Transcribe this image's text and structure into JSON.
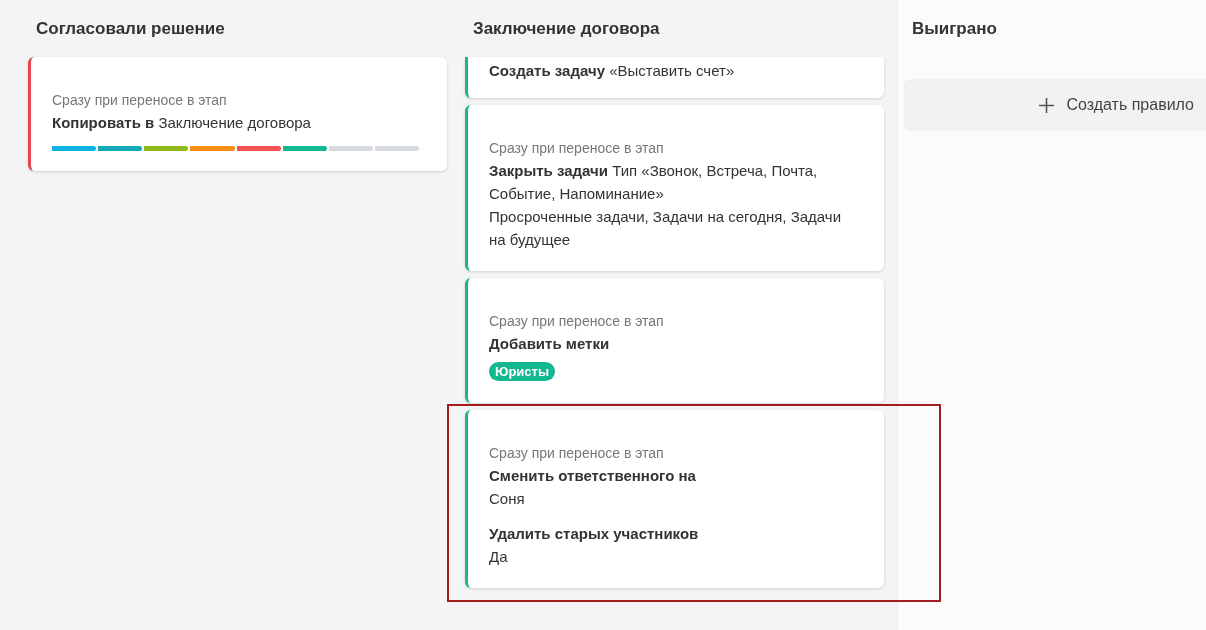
{
  "columns": [
    {
      "title": "Согласовали решение",
      "color": "#e4474f",
      "cards": [
        {
          "cut_top": false,
          "highlighted": false,
          "trigger": "Сразу при переносе в этап",
          "blocks": [
            {
              "kind": "line",
              "text": "**Копировать в** Заключение договора"
            },
            {
              "kind": "pipeline",
              "segments": [
                {
                  "color": "#0cb2e0"
                },
                {
                  "color": "#13abba"
                },
                {
                  "color": "#92b91a"
                },
                {
                  "color": "#fb8c14"
                },
                {
                  "color": "#f35353"
                },
                {
                  "color": "#14b890"
                },
                {
                  "color": "#d6dade"
                },
                {
                  "color": "#d6dade"
                }
              ]
            }
          ]
        }
      ]
    },
    {
      "title": "Заключение договора",
      "color": "#1cb58c",
      "cards": [
        {
          "cut_top": true,
          "highlighted": false,
          "blocks": [
            {
              "kind": "line",
              "text": "**Создать задачу** «Выставить счет»"
            }
          ]
        },
        {
          "cut_top": false,
          "highlighted": false,
          "trigger": "Сразу при переносе в этап",
          "blocks": [
            {
              "kind": "line",
              "text": "**Закрыть задачи** Тип «Звонок, Встреча, Почта, Событие, Напоминание»"
            },
            {
              "kind": "line",
              "text": "Просроченные задачи, Задачи на сегодня, Задачи на будущее"
            }
          ]
        },
        {
          "cut_top": false,
          "highlighted": false,
          "trigger": "Сразу при переносе в этап",
          "blocks": [
            {
              "kind": "heading",
              "text": "Добавить метки"
            },
            {
              "kind": "tag",
              "text": "Юристы",
              "color": "#14b890"
            }
          ]
        },
        {
          "cut_top": false,
          "highlighted": true,
          "trigger": "Сразу при переносе в этап",
          "blocks": [
            {
              "kind": "heading",
              "text": "Сменить ответственного на"
            },
            {
              "kind": "line",
              "text": "Соня"
            },
            {
              "kind": "heading",
              "text": "Удалить старых участников",
              "spaced": true
            },
            {
              "kind": "line",
              "text": "Да"
            }
          ]
        }
      ]
    },
    {
      "title": "Выиграно",
      "add_button": "Создать правило"
    }
  ]
}
